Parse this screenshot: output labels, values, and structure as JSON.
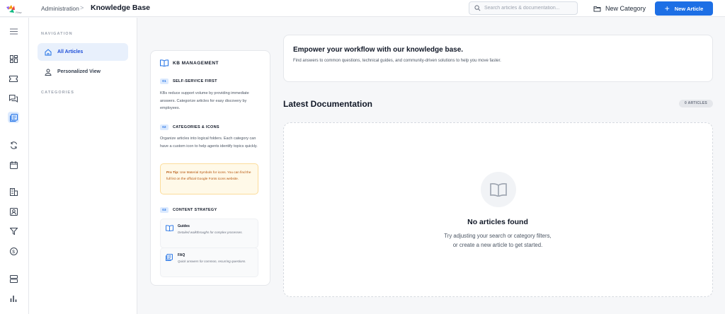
{
  "header": {
    "breadcrumb_parent": "Administration",
    "breadcrumb_separator": ">",
    "title": "Knowledge Base",
    "search_placeholder": "Search articles & documentation...",
    "new_category_label": "New Category",
    "new_article_label": "New Article",
    "new_article_icon": "+"
  },
  "rail": {
    "icons": [
      "dashboard-icon",
      "ticket-icon",
      "chat-icon",
      "knowledge-base-icon",
      "sync-icon",
      "calendar-icon",
      "building-icon",
      "contact-icon",
      "filter-icon",
      "billing-icon",
      "storage-icon",
      "analytics-icon"
    ],
    "active": "knowledge-base-icon"
  },
  "nav": {
    "heading": "NAVIGATION",
    "items": [
      {
        "label": "All Articles",
        "icon": "home-icon",
        "active": true
      },
      {
        "label": "Personalized View",
        "icon": "person-icon",
        "active": false
      }
    ],
    "categories_heading": "CATEGORIES"
  },
  "info": {
    "title": "KB MANAGEMENT",
    "sections": [
      {
        "num": "01",
        "title": "SELF-SERVICE FIRST",
        "body": "KBs reduce support volume by providing immediate answers. Categorize articles for easy discovery by employees."
      },
      {
        "num": "02",
        "title": "CATEGORIES & ICONS",
        "body": "Organize articles into logical folders. Each category can have a custom icon to help agents identify topics quickly."
      },
      {
        "num": "03",
        "title": "CONTENT STRATEGY",
        "body": ""
      }
    ],
    "protip_label": "Pro Tip:",
    "protip_text": "Use Material Symbols for icons. You can find the full list on the official Google Fonts icons website.",
    "cards": [
      {
        "title": "Guides",
        "desc": "Detailed walkthroughs for complex processes.",
        "icon": "book-icon"
      },
      {
        "title": "FAQ",
        "desc": "Quick answers for common, recurring questions.",
        "icon": "faq-icon"
      }
    ]
  },
  "banner": {
    "title": "Empower your workflow with our knowledge base.",
    "body": "Find answers to common questions, technical guides, and community-driven solutions to help you move faster."
  },
  "latest": {
    "title": "Latest Documentation",
    "count_badge": "0 ARTICLES"
  },
  "empty": {
    "title": "No articles found",
    "line1": "Try adjusting your search or category filters,",
    "line2": "or create a new article to get started."
  },
  "colors": {
    "accent": "#1d6fe5",
    "active_bg": "#e8f0fc",
    "protip_bg": "#fff9e8",
    "protip_text": "#b45309"
  }
}
